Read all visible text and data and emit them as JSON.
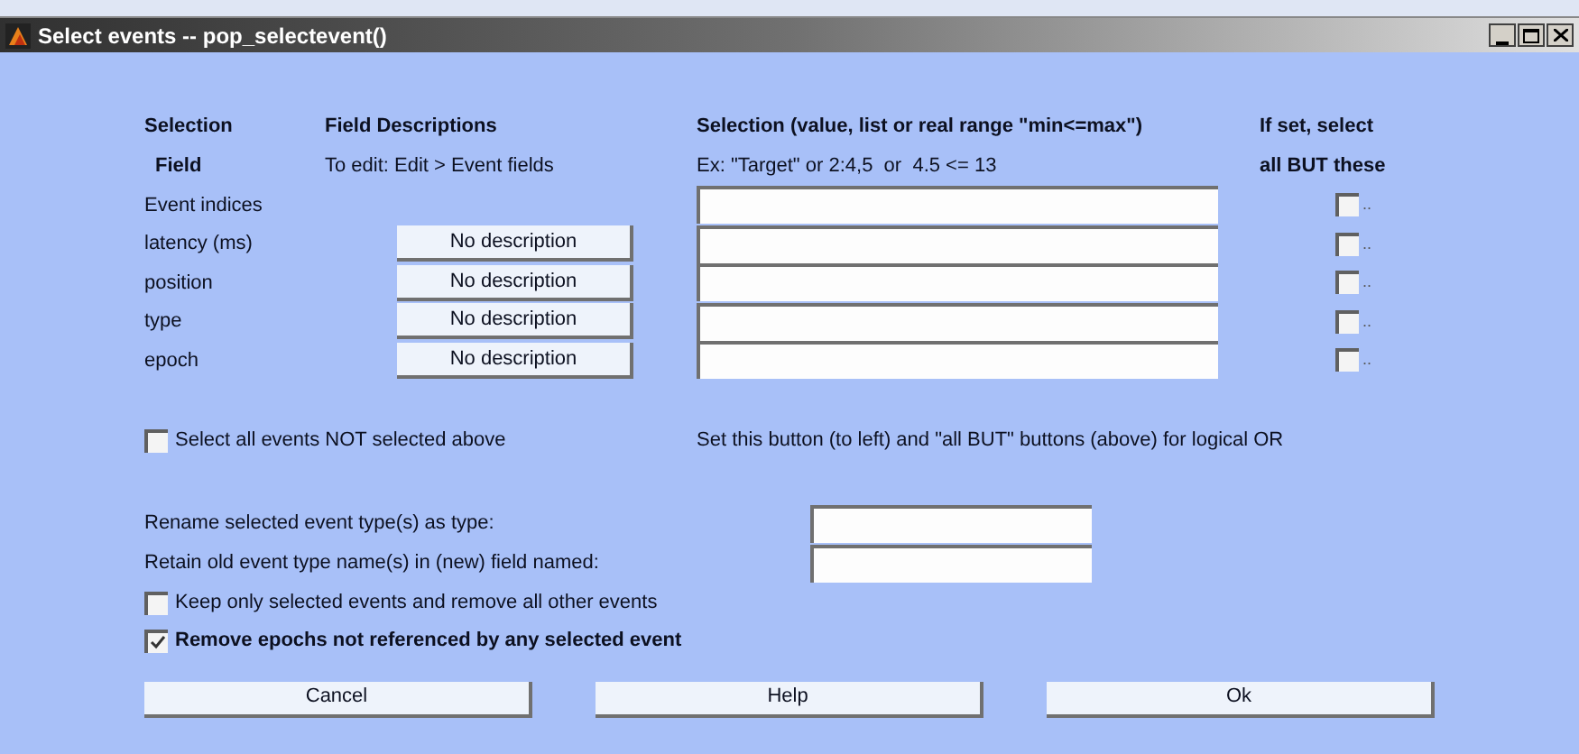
{
  "window": {
    "title": "Select events -- pop_selectevent()"
  },
  "headers": {
    "field_top": "Selection",
    "field_bottom": "Field",
    "desc_top": "Field Descriptions",
    "desc_bottom": "To edit: Edit > Event fields",
    "sel_top": "Selection (value, list or real range \"min<=max\")",
    "sel_bottom": "Ex: \"Target\" or 2:4,5  or  4.5 <= 13",
    "but_top": "If set, select",
    "but_bottom": "all BUT these"
  },
  "rows": [
    {
      "label": "Event indices",
      "checked": false,
      "suffix": ".."
    },
    {
      "label": "latency (ms)",
      "description": "No description",
      "checked": false,
      "suffix": ".."
    },
    {
      "label": "position",
      "description": "No description",
      "checked": false,
      "suffix": ".."
    },
    {
      "label": "type",
      "description": "No description",
      "checked": false,
      "suffix": ".."
    },
    {
      "label": "epoch",
      "description": "No description",
      "checked": false,
      "suffix": ".."
    }
  ],
  "select_all": {
    "label": "Select all events NOT selected above",
    "checked": false
  },
  "note": "Set this button (to left) and \"all BUT\" buttons (above) for logical OR",
  "rename_fields": [
    {
      "label": "Rename selected event type(s) as type:"
    },
    {
      "label": "Retain old event type name(s) in (new) field named:"
    }
  ],
  "options": [
    {
      "label": "Keep only selected events and remove all other events",
      "checked": false,
      "bold": false
    },
    {
      "label": "Remove epochs not referenced by any selected event",
      "checked": true,
      "bold": true
    }
  ],
  "buttons": [
    "Cancel",
    "Help",
    "Ok"
  ]
}
